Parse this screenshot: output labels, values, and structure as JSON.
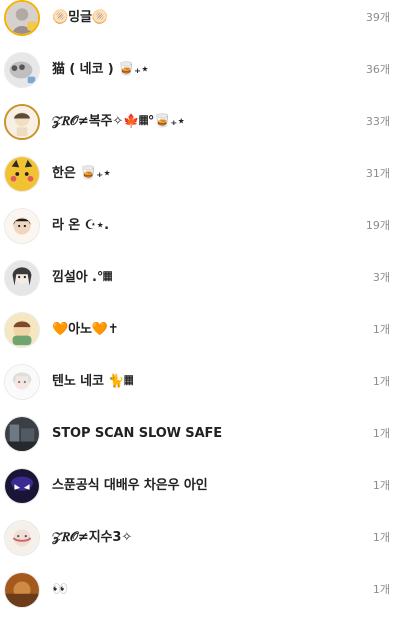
{
  "rows": [
    {
      "name": "🫓밍글🫓",
      "count": "39개"
    },
    {
      "name": "猫 ( 네코 ) 🥃₊⋆",
      "count": "36개"
    },
    {
      "name": "𝒵𝑅𝒪≠복주✧🍁𝄜°🥃₊⋆",
      "count": "33개"
    },
    {
      "name": "한은 🥃₊⋆",
      "count": "31개"
    },
    {
      "name": "라 온 ☪︎⋆.",
      "count": "19개"
    },
    {
      "name": "낌설아 .°𝄜",
      "count": "3개"
    },
    {
      "name": "🧡아노🧡✝",
      "count": "1개"
    },
    {
      "name": "텐노 네코 🐈𝄜",
      "count": "1개"
    },
    {
      "name": "STOP SCAN SLOW SAFE",
      "count": "1개"
    },
    {
      "name": "스푼공식 대배우 차은우 아인",
      "count": "1개"
    },
    {
      "name": "𝒵𝑅𝒪≠지수3✧",
      "count": "1개"
    },
    {
      "name": "👀",
      "count": "1개"
    }
  ],
  "avatars": [
    {
      "icon": "user-photo-icon",
      "bg": "#c9c2bf",
      "ring": "#f5b100"
    },
    {
      "icon": "cat-photo-icon",
      "bg": "#e2e2e2"
    },
    {
      "icon": "anime-photo-icon",
      "bg": "#f4ebd8",
      "ring": "#c8922a"
    },
    {
      "icon": "pikachu-photo-icon",
      "bg": "#f1c232"
    },
    {
      "icon": "cartoon-face-icon",
      "bg": "#f7f1e8"
    },
    {
      "icon": "anime-girl-icon",
      "bg": "#d8d8d8"
    },
    {
      "icon": "cartoon-character-icon",
      "bg": "#f4e4b8"
    },
    {
      "icon": "anime-white-hair-icon",
      "bg": "#f5f5f5"
    },
    {
      "icon": "dark-photo-icon",
      "bg": "#3b3f44"
    },
    {
      "icon": "face-mask-icon",
      "bg": "#1d1a3b"
    },
    {
      "icon": "sketch-face-icon",
      "bg": "#f1e7df"
    },
    {
      "icon": "brown-photo-icon",
      "bg": "#a45a1d"
    }
  ]
}
